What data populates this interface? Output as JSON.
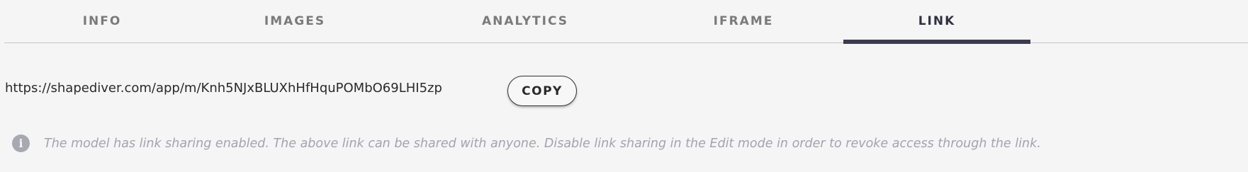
{
  "tabs": [
    {
      "label": "INFO"
    },
    {
      "label": "IMAGES"
    },
    {
      "label": "ANALYTICS"
    },
    {
      "label": "IFRAME"
    },
    {
      "label": "LINK"
    }
  ],
  "active_tab": "LINK",
  "link": {
    "url": "https://shapediver.com/app/m/Knh5NJxBLUXhHfHquPOMbO69LHI5zp",
    "copy_label": "COPY"
  },
  "info": {
    "icon": "info-icon",
    "text": "The model has link sharing enabled. The above link can be shared with anyone. Disable link sharing in the Edit mode in order to revoke access through the link."
  },
  "colors": {
    "active_tab_indicator": "#3b3b4f",
    "background": "#f5f5f5",
    "info_text": "#a3a3b0"
  }
}
